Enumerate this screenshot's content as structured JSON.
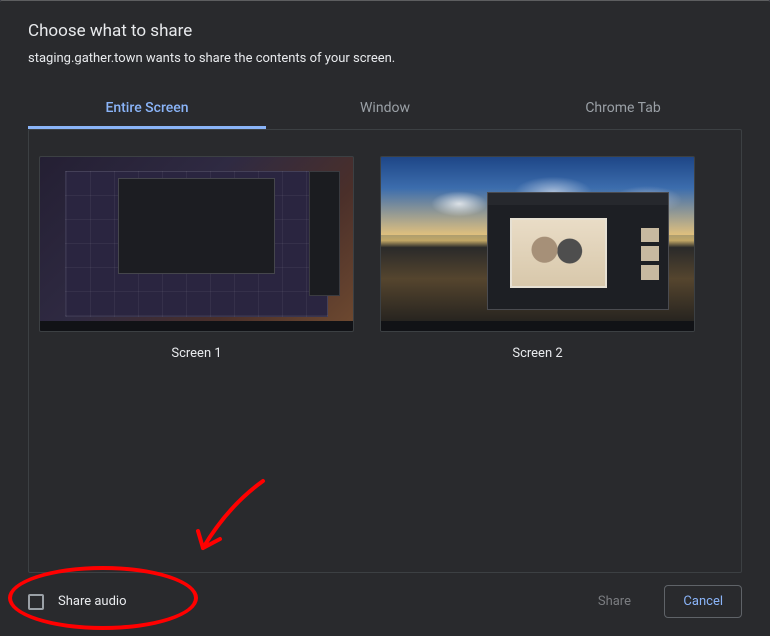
{
  "dialog": {
    "title": "Choose what to share",
    "subtitle": "staging.gather.town wants to share the contents of your screen."
  },
  "tabs": {
    "entire_screen": "Entire Screen",
    "window": "Window",
    "chrome_tab": "Chrome Tab",
    "active": "entire_screen"
  },
  "screens": [
    {
      "label": "Screen 1"
    },
    {
      "label": "Screen 2"
    }
  ],
  "footer": {
    "share_audio_label": "Share audio",
    "share_button": "Share",
    "cancel_button": "Cancel"
  }
}
